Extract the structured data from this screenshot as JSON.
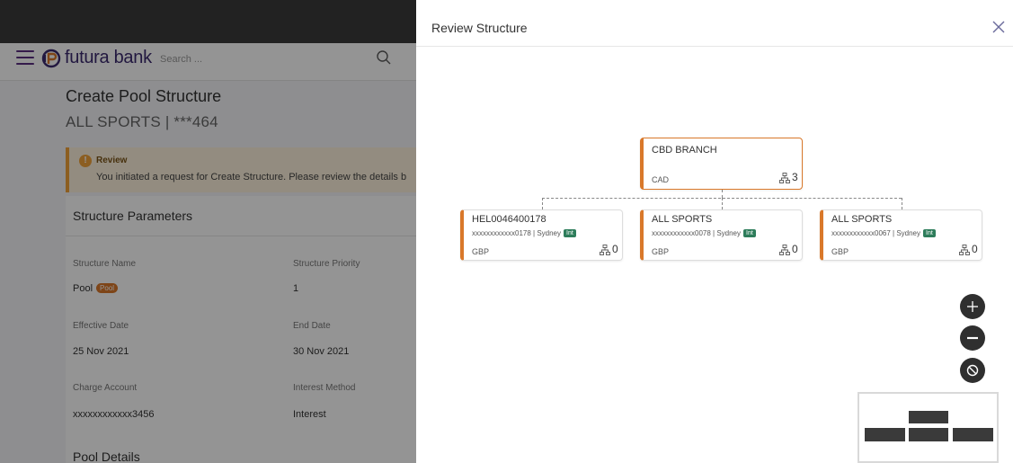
{
  "app": {
    "brand": "futura bank",
    "search_placeholder": "Search ...",
    "accent_color": "#5a2d82",
    "node_accent_color": "#d9782a"
  },
  "background_page": {
    "title": "Create Pool Structure",
    "subtitle": "ALL SPORTS | ***464",
    "review": {
      "title": "Review",
      "message": "You initiated a request for Create Structure. Please review the details b"
    },
    "section_title": "Structure Parameters",
    "fields": [
      {
        "label": "Structure Name",
        "value": "Pool",
        "badge": "Pool"
      },
      {
        "label": "Structure Priority",
        "value": "1"
      },
      {
        "label": "Effective Date",
        "value": "25 Nov 2021"
      },
      {
        "label": "End Date",
        "value": "30 Nov 2021"
      },
      {
        "label": "Charge Account",
        "value": "xxxxxxxxxxxx3456"
      },
      {
        "label": "Interest Method",
        "value": "Interest"
      }
    ],
    "pool_details_title": "Pool Details"
  },
  "modal": {
    "title": "Review Structure",
    "root": {
      "name": "CBD BRANCH",
      "currency": "CAD",
      "count": "3"
    },
    "children": [
      {
        "name": "HEL0046400178",
        "account": "xxxxxxxxxxxx0178 | Sydney",
        "badge": "Int",
        "currency": "GBP",
        "count": "0"
      },
      {
        "name": "ALL SPORTS",
        "account": "xxxxxxxxxxxx0078 | Sydney",
        "badge": "Int",
        "currency": "GBP",
        "count": "0"
      },
      {
        "name": "ALL SPORTS",
        "account": "xxxxxxxxxxxx0067 | Sydney",
        "badge": "Int",
        "currency": "GBP",
        "count": "0"
      }
    ],
    "controls": [
      "zoom-in",
      "zoom-out",
      "reset"
    ]
  }
}
